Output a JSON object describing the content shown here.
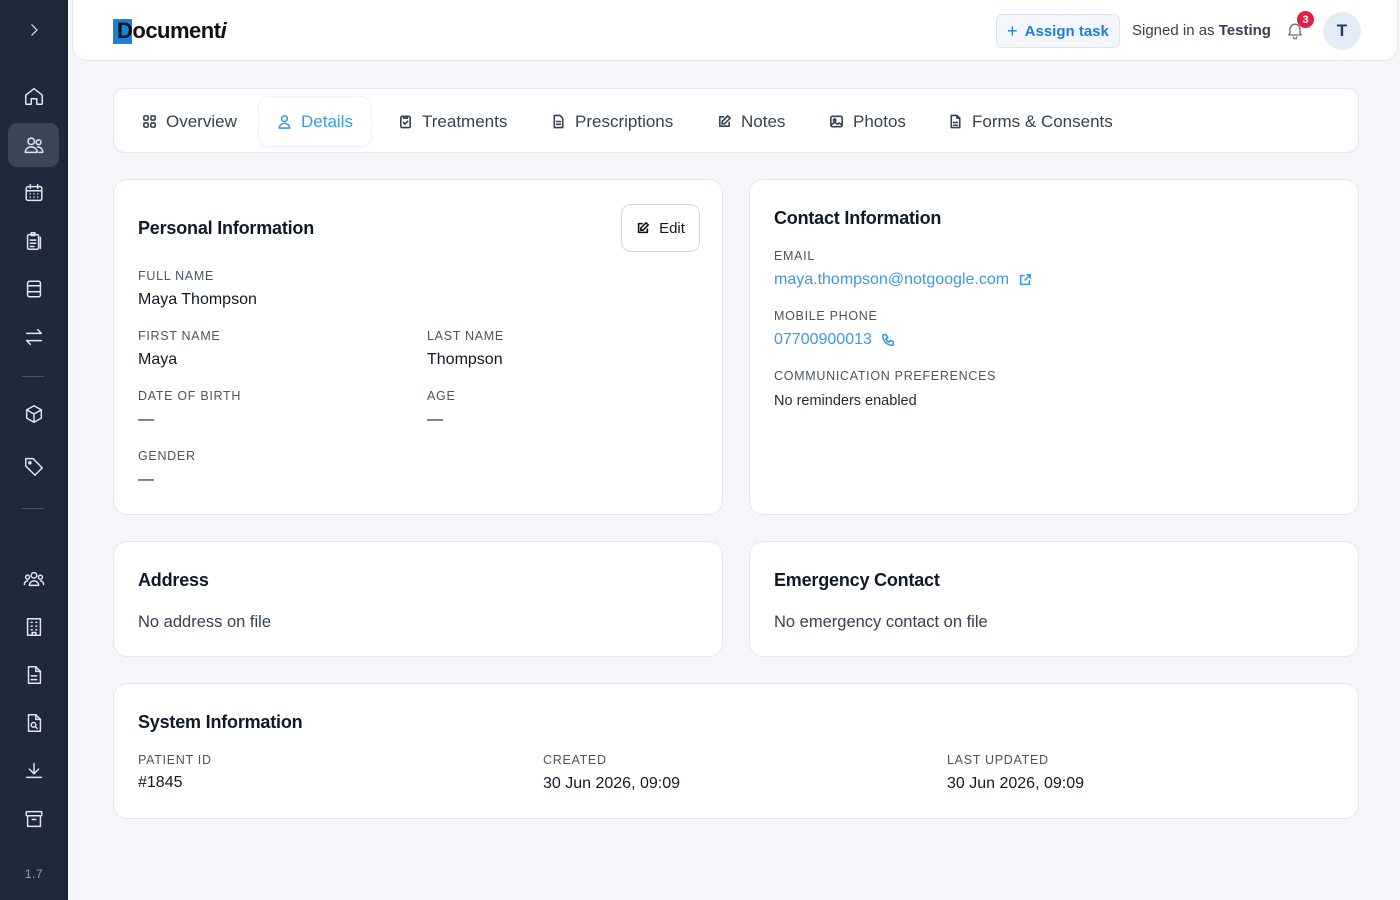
{
  "app": {
    "version": "1.7"
  },
  "header": {
    "logo_text_main": "Document",
    "logo_text_suffix": "i",
    "assign_label": "Assign task",
    "signed_in_prefix": "Signed in as",
    "signed_in_user": "Testing",
    "notification_count": "3",
    "avatar_initial": "T"
  },
  "tabs": [
    {
      "label": "Overview",
      "icon": "grid-icon"
    },
    {
      "label": "Details",
      "icon": "user-icon",
      "active": true
    },
    {
      "label": "Treatments",
      "icon": "clipboard-check-icon"
    },
    {
      "label": "Prescriptions",
      "icon": "file-text-icon"
    },
    {
      "label": "Notes",
      "icon": "edit-icon"
    },
    {
      "label": "Photos",
      "icon": "image-icon"
    },
    {
      "label": "Forms & Consents",
      "icon": "document-icon"
    }
  ],
  "personal": {
    "title": "Personal Information",
    "edit_label": "Edit",
    "full_name_label": "FULL NAME",
    "full_name": "Maya Thompson",
    "first_name_label": "FIRST NAME",
    "first_name": "Maya",
    "last_name_label": "LAST NAME",
    "last_name": "Thompson",
    "dob_label": "DATE OF BIRTH",
    "dob": "—",
    "age_label": "AGE",
    "age": "—",
    "gender_label": "GENDER",
    "gender": "—"
  },
  "contact": {
    "title": "Contact Information",
    "email_label": "EMAIL",
    "email": "maya.thompson@notgoogle.com",
    "phone_label": "MOBILE PHONE",
    "phone": "07700900013",
    "prefs_label": "COMMUNICATION PREFERENCES",
    "prefs": "No reminders enabled"
  },
  "address": {
    "title": "Address",
    "empty": "No address on file"
  },
  "emergency": {
    "title": "Emergency Contact",
    "empty": "No emergency contact on file"
  },
  "system": {
    "title": "System Information",
    "patient_id_label": "PATIENT ID",
    "patient_id": "#1845",
    "created_label": "CREATED",
    "created": "30 Jun 2026, 09:09",
    "updated_label": "LAST UPDATED",
    "updated": "30 Jun 2026, 09:09"
  },
  "colors": {
    "sidebar_bg": "#1e293b",
    "accent": "#3b9ae1",
    "badge": "#e11d48"
  }
}
